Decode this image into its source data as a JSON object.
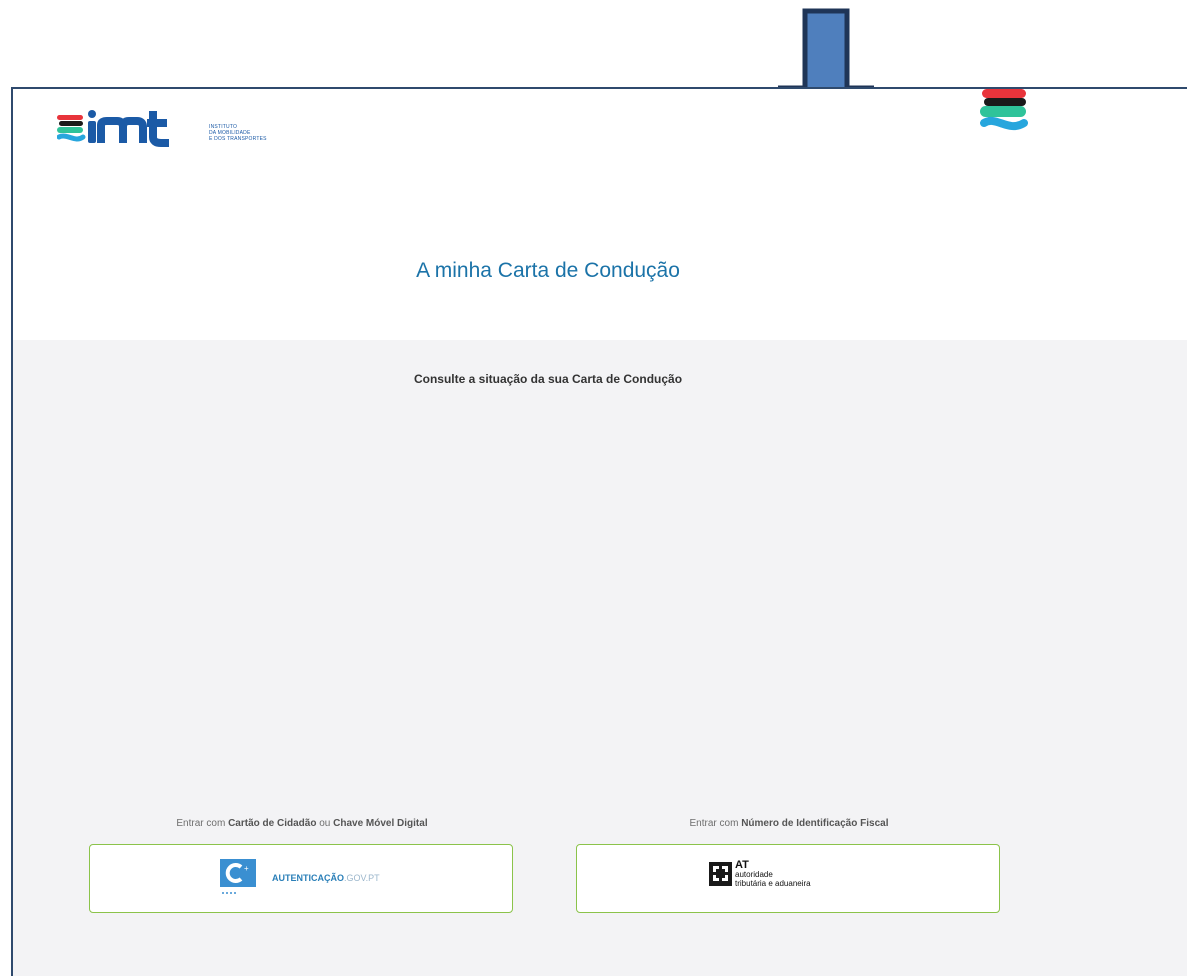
{
  "brand": {
    "logo_word": "imt",
    "logo_sub": [
      "INSTITUTO",
      "DA MOBILIDADE",
      "E DOS TRANSPORTES"
    ]
  },
  "page": {
    "title": "A minha Carta de Condução",
    "subtitle": "Consulte a situação da sua Carta de Condução"
  },
  "login": {
    "option1": {
      "caption_prefix": "Entrar com ",
      "caption_bold1": "Cartão de Cidadão",
      "caption_mid": " ou ",
      "caption_bold2": "Chave Móvel Digital",
      "button_main": "AUTENTICAÇÃO",
      "button_suffix": ".GOV.PT"
    },
    "option2": {
      "caption_prefix": "Entrar com ",
      "caption_bold": "Número de Identificação Fiscal",
      "button_title": "AT",
      "button_line1": "autoridade",
      "button_line2": "tributária e aduaneira"
    }
  },
  "colors": {
    "title": "#1b73a8",
    "button_border": "#8bc34a",
    "arrow_fill": "#4f7fbd",
    "arrow_stroke": "#1f3557",
    "page_bg": "#f3f3f5"
  },
  "icons": [
    "imt-logo-icon",
    "imt-symbol-icon",
    "autenticacao-gov-icon",
    "at-emblem-icon",
    "down-arrow-icon"
  ]
}
